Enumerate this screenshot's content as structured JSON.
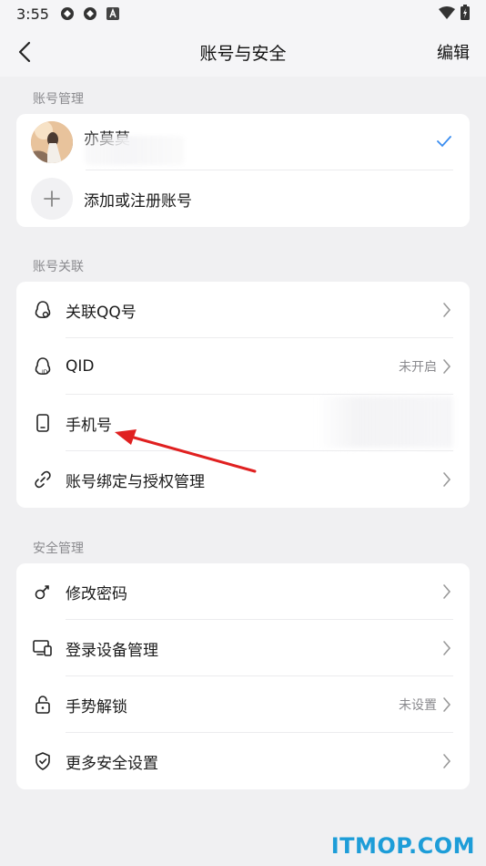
{
  "status_bar": {
    "time": "3:55"
  },
  "header": {
    "title": "账号与安全",
    "edit_label": "编辑"
  },
  "account_section": {
    "label": "账号管理",
    "account_name": "亦莫莫",
    "add_label": "添加或注册账号"
  },
  "link_section": {
    "label": "账号关联",
    "items": [
      {
        "label": "关联QQ号",
        "value": ""
      },
      {
        "label": "QID",
        "value": "未开启"
      },
      {
        "label": "手机号",
        "value": ""
      },
      {
        "label": "账号绑定与授权管理",
        "value": ""
      }
    ]
  },
  "security_section": {
    "label": "安全管理",
    "items": [
      {
        "label": "修改密码",
        "value": ""
      },
      {
        "label": "登录设备管理",
        "value": ""
      },
      {
        "label": "手势解锁",
        "value": "未设置"
      },
      {
        "label": "更多安全设置",
        "value": ""
      }
    ]
  },
  "watermark": "ITMOP.COM",
  "colors": {
    "accent": "#3a8df0",
    "annotation_arrow": "#e02020",
    "watermark": "#1d9dd8"
  }
}
